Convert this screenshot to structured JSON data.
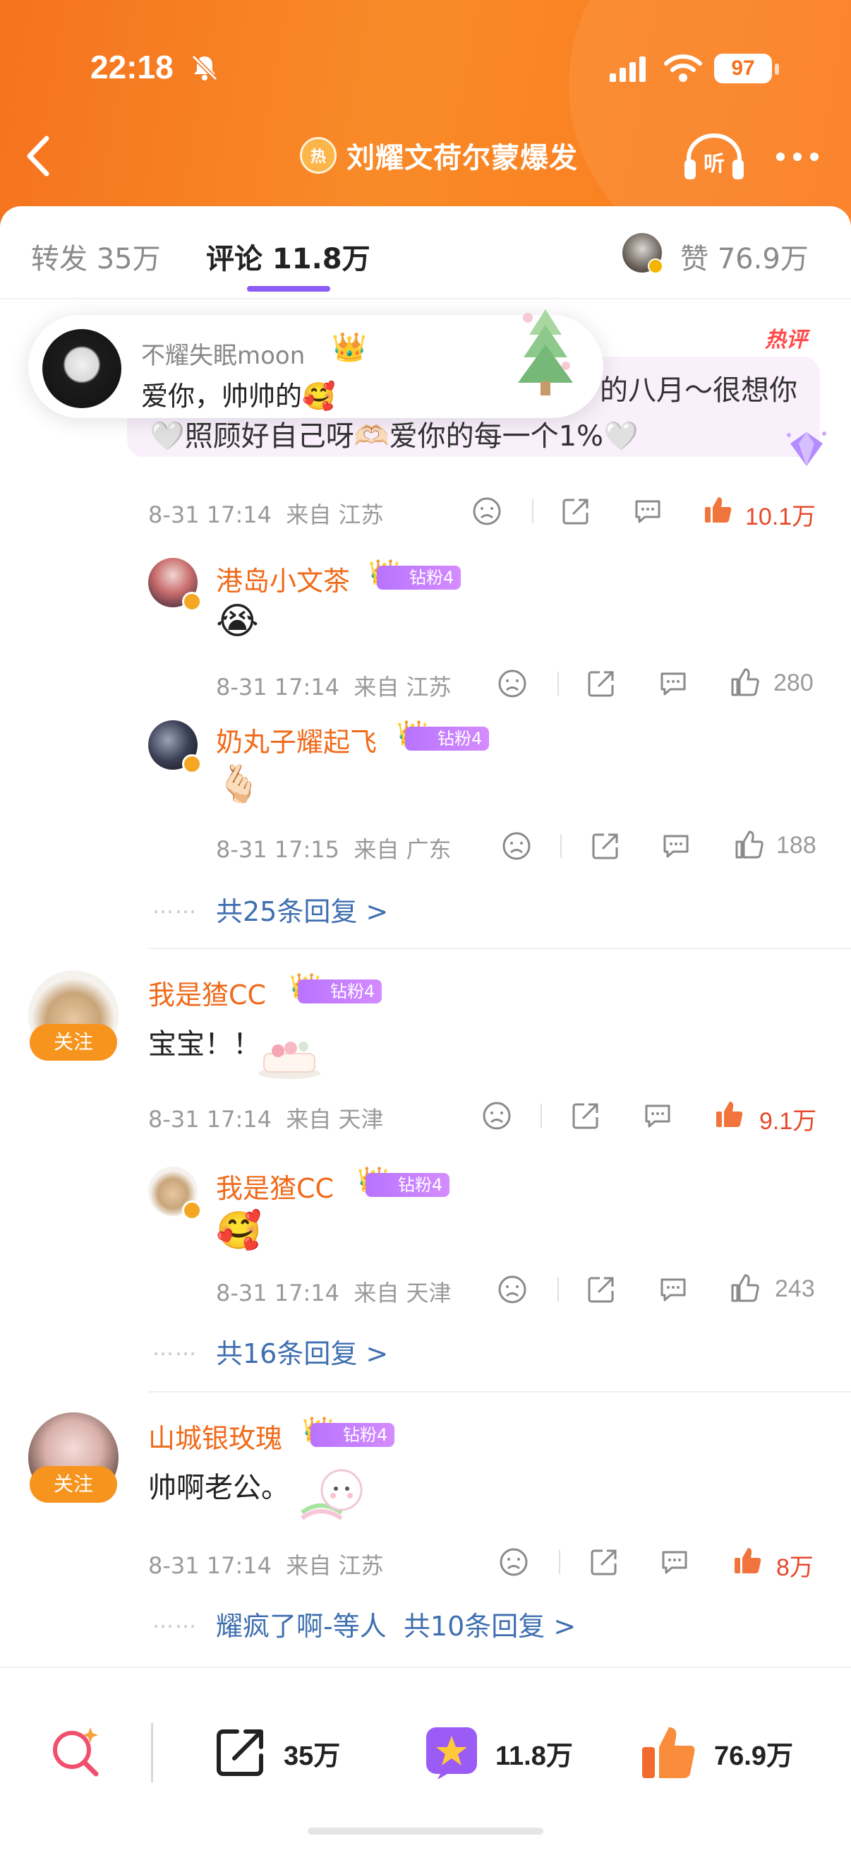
{
  "status_bar": {
    "time": "22:18",
    "battery": "97"
  },
  "header": {
    "title": "刘耀文荷尔蒙爆发",
    "hot_icon_text": "热"
  },
  "tabs": {
    "repost": "转发 35万",
    "comments": "评论 11.8万",
    "likes": "赞 76.9万"
  },
  "top_comment": {
    "hot_tag": "热评",
    "text_line1": "的八月～很想你",
    "text_line2": "🤍照顾好自己呀🫶🏻爱你的每一个1%🤍",
    "time": "8-31 17:14",
    "location": "来自 江苏",
    "likes": "10.1万",
    "replies": [
      {
        "name": "港岛小文茶",
        "fan_badge": "钻粉4",
        "emoji": "😭",
        "time": "8-31 17:14",
        "location": "来自 江苏",
        "likes": "280"
      },
      {
        "name": "奶丸子耀起飞",
        "fan_badge": "钻粉4",
        "emoji": "🫰🏻",
        "time": "8-31 17:15",
        "location": "来自 广东",
        "likes": "188"
      }
    ],
    "more_replies": "共25条回复 >"
  },
  "toast": {
    "name": "不耀失眠moon",
    "message": "爱你，帅帅的🥰"
  },
  "comment2": {
    "name": "我是猹CC",
    "fan_badge": "钻粉4",
    "follow": "关注",
    "text": "宝宝！！",
    "time": "8-31 17:14",
    "location": "来自 天津",
    "likes": "9.1万",
    "reply": {
      "name": "我是猹CC",
      "fan_badge": "钻粉4",
      "emoji": "🥰",
      "time": "8-31 17:14",
      "location": "来自 天津",
      "likes": "243"
    },
    "more_replies": "共16条回复 >"
  },
  "comment3": {
    "name": "山城银玫瑰",
    "fan_badge": "钻粉4",
    "follow": "关注",
    "text": "帅啊老公。",
    "time": "8-31 17:14",
    "location": "来自 江苏",
    "likes": "8万",
    "more_replies_user": "耀疯了啊-等人",
    "more_replies": "共10条回复 >"
  },
  "bottom_bar": {
    "reposts": "35万",
    "comments": "11.8万",
    "likes": "76.9万"
  }
}
